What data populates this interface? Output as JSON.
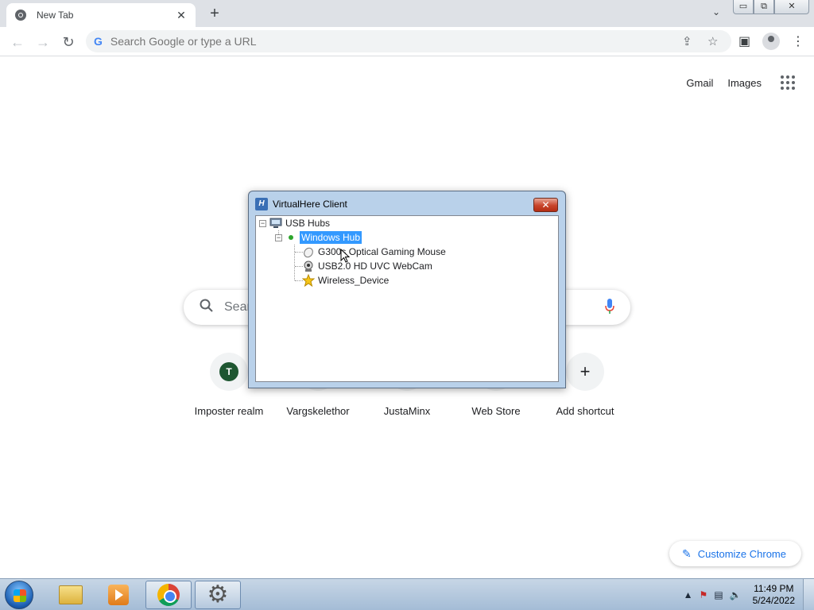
{
  "browser": {
    "tab_title": "New Tab",
    "tab_close": "✕",
    "new_tab": "+",
    "tab_search": "⌄",
    "window_buttons": {
      "minimize": "▭",
      "restore": "⧉",
      "close": "✕"
    }
  },
  "toolbar": {
    "back": "←",
    "forward": "→",
    "reload": "↻",
    "omnibox_placeholder": "Search Google or type a URL",
    "share": "⇪",
    "bookmark": "☆",
    "side_panel": "▣",
    "menu": "⋮"
  },
  "ntp": {
    "gmail": "Gmail",
    "images": "Images",
    "search_placeholder": "Sear",
    "shortcuts": [
      {
        "label": "Imposter realm",
        "icon_letter": "T"
      },
      {
        "label": "Vargskelethor"
      },
      {
        "label": "JustaMinx"
      },
      {
        "label": "Web Store"
      },
      {
        "label": "Add shortcut",
        "icon": "+"
      }
    ],
    "customize_label": "Customize Chrome"
  },
  "vh_dialog": {
    "title": "VirtualHere Client",
    "close": "✕",
    "tree": {
      "root": "USB Hubs",
      "hub": "Windows Hub",
      "devices": [
        "G300s Optical Gaming Mouse",
        "USB2.0 HD UVC WebCam",
        "Wireless_Device"
      ]
    }
  },
  "taskbar": {
    "clock_time": "11:49 PM",
    "clock_date": "5/24/2022"
  }
}
